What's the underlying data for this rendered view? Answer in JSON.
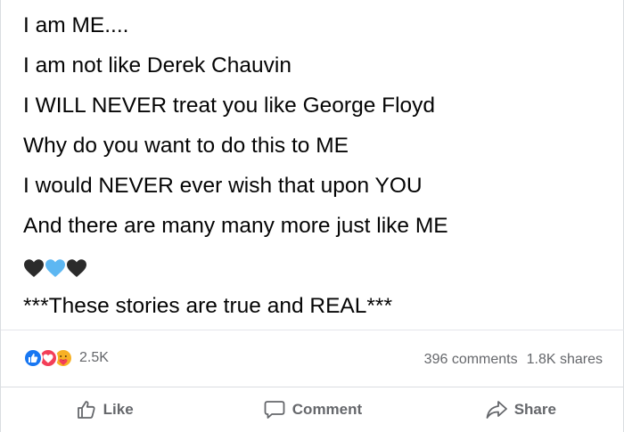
{
  "post": {
    "lines": [
      "I am ME....",
      "I am not like Derek Chauvin",
      "I WILL NEVER treat you like George Floyd",
      "Why do you want to do this to ME",
      "I would NEVER ever wish that upon YOU",
      "And there are many many more just like ME"
    ],
    "hearts": [
      "black-heart-icon",
      "blue-heart-icon",
      "black-heart-icon"
    ],
    "closing_line": "***These stories are true and REAL***"
  },
  "stats": {
    "reaction_icons": [
      "like-reaction-icon",
      "love-reaction-icon",
      "care-reaction-icon"
    ],
    "reaction_count": "2.5K",
    "comments": "396 comments",
    "shares": "1.8K shares"
  },
  "actions": {
    "like_label": "Like",
    "comment_label": "Comment",
    "share_label": "Share"
  },
  "colors": {
    "like_blue": "#1877f2",
    "love_red": "#f33e58",
    "care_yellow": "#f7b125",
    "muted_text": "#65676b",
    "heart_black": "#2b2b2b",
    "heart_blue": "#5db7f2"
  }
}
